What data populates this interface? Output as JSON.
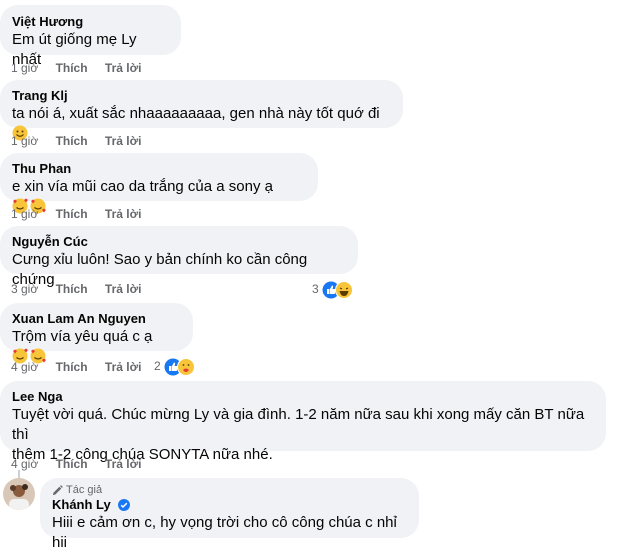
{
  "actions": {
    "like": "Thích",
    "reply": "Trả lời"
  },
  "comments": [
    {
      "author": "Việt Hương",
      "text": "Em út giống mẹ Ly nhất",
      "time": "1 giờ"
    },
    {
      "author": "Trang Klj",
      "text": "ta nói á, xuất sắc nhaaaaaaaaa, gen nhà này tốt quớ đi",
      "time": "1 giờ"
    },
    {
      "author": "Thu Phan",
      "text": "e xin vía mũi cao da trắng của a sony ạ",
      "time": "1 giờ"
    },
    {
      "author": "Nguyễn Cúc",
      "text": "Cưng xỉu luôn! Sao y bản chính ko cần công chứng",
      "time": "3 giờ",
      "reactions": "3"
    },
    {
      "author": "Xuan Lam An Nguyen",
      "text": "Trộm vía yêu quá c ạ",
      "time": "4 giờ",
      "reactions": "2"
    },
    {
      "author": "Lee Nga",
      "text_line1": "Tuyệt vời quá. Chúc mừng Ly và gia đình. 1-2 năm nữa sau khi xong mấy căn BT nữa thì",
      "text_line2": "thêm 1-2 công chúa SONYTA nữa nhé.",
      "time": "4 giờ"
    }
  ],
  "reply": {
    "badge": "Tác giả",
    "author": "Khánh Ly",
    "text": "Hiii e cảm ơn c, hy vọng trời cho cô công chúa c nhỉ hii"
  }
}
